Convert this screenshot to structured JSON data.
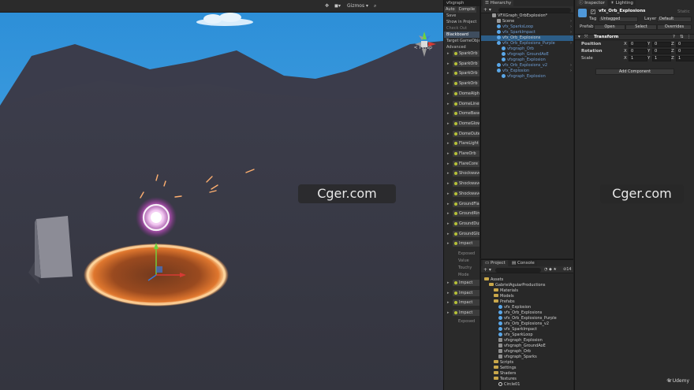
{
  "scene": {
    "gizmos_label": "Gizmos",
    "persp_label": "< Persp",
    "watermark": "Cger.com"
  },
  "vfx_panel": {
    "tab_title": "vfxgraph",
    "buttons": [
      "Auto",
      "Compile"
    ],
    "context_menu": [
      {
        "label": "Save",
        "state": "normal"
      },
      {
        "label": "Show in Project",
        "state": "normal"
      },
      {
        "label": "Check Out",
        "state": "dim"
      },
      {
        "label": "Blackboard",
        "state": "sel"
      },
      {
        "label": "Target GameObject",
        "state": "normal"
      },
      {
        "label": "Advanced",
        "state": "normal"
      }
    ],
    "nodes": [
      "SparkOrb",
      "SparkOrb",
      "SparkOrb",
      "SparkOrb",
      "DomeAlpha",
      "DomeLines",
      "DomeBase",
      "DomeGlow",
      "DomeOuter",
      "FlareLight",
      "FlareOrb",
      "FlareCore",
      "Shockwave",
      "Shockwave",
      "Shockwave",
      "GroundFlare",
      "GroundRing",
      "GroundDust",
      "GroundGlow",
      "Impact"
    ],
    "sub_labels": [
      "Exposed",
      "Value",
      "Touchy",
      "Mode"
    ],
    "nodes_2": [
      "Impact",
      "Impact",
      "Impact",
      "Impact"
    ],
    "bottom_label": "Exposed"
  },
  "hierarchy": {
    "tab_title": "Hierarchy",
    "rows": [
      {
        "label": "VFXGraph_OrbExplosion*",
        "indent": 0,
        "icon": "unity-scene-icon",
        "style": "normal"
      },
      {
        "label": "Scene",
        "indent": 1,
        "icon": "gameobject-icon",
        "style": "normal"
      },
      {
        "label": "vfx_SparksLoop",
        "indent": 1,
        "icon": "prefab-icon",
        "style": "link"
      },
      {
        "label": "vfx_SparkImpact",
        "indent": 1,
        "icon": "prefab-icon",
        "style": "link"
      },
      {
        "label": "vfx_Orb_Explosions",
        "indent": 1,
        "icon": "prefab-icon",
        "style": "sel"
      },
      {
        "label": "vfx_Orb_Explosions_Purple",
        "indent": 1,
        "icon": "prefab-icon",
        "style": "link"
      },
      {
        "label": "vfxgraph_Orb",
        "indent": 2,
        "icon": "vfx-icon",
        "style": "link"
      },
      {
        "label": "vfxgraph_GroundAoE",
        "indent": 2,
        "icon": "vfx-icon",
        "style": "link"
      },
      {
        "label": "vfxgraph_Explosion",
        "indent": 2,
        "icon": "vfx-icon",
        "style": "link"
      },
      {
        "label": "vfx_Orb_Explosions_v2",
        "indent": 1,
        "icon": "prefab-icon",
        "style": "link"
      },
      {
        "label": "vfx_Explosion",
        "indent": 1,
        "icon": "prefab-icon",
        "style": "link"
      },
      {
        "label": "vfxgraph_Explosion",
        "indent": 2,
        "icon": "vfx-icon",
        "style": "link"
      }
    ]
  },
  "project": {
    "tabs": [
      "Project",
      "Console"
    ],
    "badge": "14",
    "rows": [
      {
        "label": "Assets",
        "indent": 0,
        "type": "folder"
      },
      {
        "label": "GabrielAguiarProductions",
        "indent": 1,
        "type": "folder"
      },
      {
        "label": "Materials",
        "indent": 2,
        "type": "folder"
      },
      {
        "label": "Models",
        "indent": 2,
        "type": "folder"
      },
      {
        "label": "Prefabs",
        "indent": 2,
        "type": "folder"
      },
      {
        "label": "vfx_Explosion",
        "indent": 3,
        "type": "prefab"
      },
      {
        "label": "vfx_Orb_Explosions",
        "indent": 3,
        "type": "prefab"
      },
      {
        "label": "vfx_Orb_Explosions_Purple",
        "indent": 3,
        "type": "prefab"
      },
      {
        "label": "vfx_Orb_Explosions_v2",
        "indent": 3,
        "type": "prefab"
      },
      {
        "label": "vfx_SparkImpact",
        "indent": 3,
        "type": "prefab"
      },
      {
        "label": "vfx_SparkLoop",
        "indent": 3,
        "type": "prefab"
      },
      {
        "label": "vfxgraph_Explosion",
        "indent": 3,
        "type": "vfx"
      },
      {
        "label": "vfxgraph_GroundAoE",
        "indent": 3,
        "type": "vfx"
      },
      {
        "label": "vfxgraph_Orb",
        "indent": 3,
        "type": "vfx"
      },
      {
        "label": "vfxgraph_Sparks",
        "indent": 3,
        "type": "vfx"
      },
      {
        "label": "Scripts",
        "indent": 2,
        "type": "folder"
      },
      {
        "label": "Settings",
        "indent": 2,
        "type": "folder"
      },
      {
        "label": "Shaders",
        "indent": 2,
        "type": "folder"
      },
      {
        "label": "Textures",
        "indent": 2,
        "type": "folder"
      },
      {
        "label": "Circle01",
        "indent": 3,
        "type": "texture"
      }
    ]
  },
  "inspector": {
    "tabs": [
      "Inspector",
      "Lighting"
    ],
    "object_name": "vfx_Orb_Explosions",
    "static_label": "Static",
    "tag_label": "Tag",
    "tag_value": "Untagged",
    "layer_label": "Layer",
    "layer_value": "Default",
    "prefab_label": "Prefab",
    "prefab_buttons": [
      "Open",
      "Select",
      "Overrides"
    ],
    "component_title": "Transform",
    "transform": [
      {
        "label": "Position",
        "x": "0",
        "y": "0",
        "z": "0"
      },
      {
        "label": "Rotation",
        "x": "0",
        "y": "0",
        "z": "0"
      },
      {
        "label": "Scale",
        "x": "1",
        "y": "1",
        "z": "1"
      }
    ],
    "axis_labels": [
      "X",
      "Y",
      "Z"
    ],
    "add_component_label": "Add Component",
    "watermark": "Cger.com",
    "brand": "Udemy"
  }
}
